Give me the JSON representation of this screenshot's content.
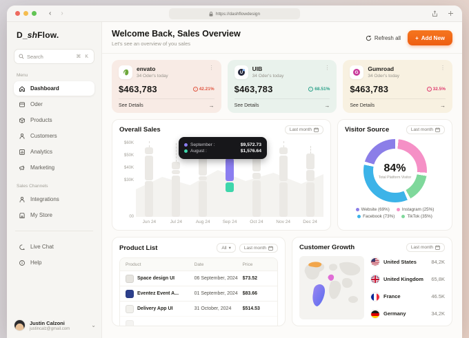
{
  "browser": {
    "url": "https://dashflowdesign"
  },
  "sidebar": {
    "logo_a": "D_",
    "logo_b": "sh",
    "logo_c": "Flow.",
    "search": {
      "placeholder": "Search",
      "shortcut": "⌘ K"
    },
    "menu_label": "Menu",
    "menu": [
      {
        "label": "Dashboard",
        "icon": "home-icon",
        "active": true
      },
      {
        "label": "Oder",
        "icon": "order-icon",
        "active": false
      },
      {
        "label": "Products",
        "icon": "products-icon",
        "active": false
      },
      {
        "label": "Customers",
        "icon": "customers-icon",
        "active": false
      },
      {
        "label": "Analytics",
        "icon": "analytics-icon",
        "active": false
      },
      {
        "label": "Marketing",
        "icon": "marketing-icon",
        "active": false
      }
    ],
    "sales_label": "Sales Channels",
    "sales": [
      {
        "label": "Integrations",
        "icon": "integrations-icon"
      },
      {
        "label": "My Store",
        "icon": "store-icon"
      }
    ],
    "footer": [
      {
        "label": "Live Chat",
        "icon": "chat-icon"
      },
      {
        "label": "Help",
        "icon": "help-icon"
      }
    ],
    "user": {
      "name": "Justin Calzoni",
      "email": "justincalz@gmail.com"
    }
  },
  "header": {
    "title": "Welcome Back, Sales Overview",
    "subtitle": "Let's see an overview of you sales",
    "refresh_label": "Refresh all",
    "add_label": "Add New"
  },
  "stat_cards": [
    {
      "name": "envato",
      "subtitle": "34 Oder's today",
      "value": "$463,783",
      "delta": "42.21%",
      "delta_color": "#e05540",
      "bg": "#f8ebe5",
      "logo": "envato",
      "see_details": "See Details"
    },
    {
      "name": "UIB",
      "subtitle": "34 Oder's today",
      "value": "$463,783",
      "delta": "68.51%",
      "delta_color": "#2ba189",
      "bg": "#e9f2ec",
      "logo": "uib",
      "see_details": "See Details"
    },
    {
      "name": "Gumroad",
      "subtitle": "34 Oder's today",
      "value": "$463,783",
      "delta": "32.5%",
      "delta_color": "#df3a6e",
      "bg": "#f8f1e1",
      "logo": "gumroad",
      "see_details": "See Details"
    }
  ],
  "overall_sales": {
    "title": "Overall Sales",
    "period_label": "Last month",
    "chart_data": {
      "type": "bar",
      "title": "Overall Sales",
      "x": [
        "Jun 24",
        "Jul 24",
        "Aug 24",
        "Sep 24",
        "Oct 24",
        "Nov 24",
        "Dec 24"
      ],
      "ylabels": [
        {
          "v": 60,
          "t": "$60K"
        },
        {
          "v": 50,
          "t": "$50K"
        },
        {
          "v": 40,
          "t": "$40K"
        },
        {
          "v": 30,
          "t": "$30K"
        },
        {
          "v": 0,
          "t": "00"
        }
      ],
      "ylim": [
        0,
        63
      ],
      "unit": "K USD",
      "bars": [
        {
          "month": "Jun 24",
          "wick": 62,
          "segments": [
            {
              "from": 0,
              "to": 29
            },
            {
              "from": 30,
              "to": 50
            },
            {
              "from": 51,
              "to": 57
            }
          ]
        },
        {
          "month": "Jul 24",
          "wick": 60,
          "segments": [
            {
              "from": 0,
              "to": 34
            },
            {
              "from": 35,
              "to": 38
            },
            {
              "from": 39,
              "to": 45
            }
          ]
        },
        {
          "month": "Aug 24",
          "wick": 58,
          "segments": [
            {
              "from": 0,
              "to": 29
            },
            {
              "from": 30,
              "to": 33
            },
            {
              "from": 34,
              "to": 50
            }
          ]
        },
        {
          "month": "Sep 24",
          "wick": 56,
          "highlight": true,
          "segments": [
            {
              "from": 20,
              "to": 28,
              "color": "#3ed6ab"
            },
            {
              "from": 29.5,
              "to": 48,
              "color": "#8b7ef0"
            },
            {
              "from": 48.5,
              "to": 53,
              "color": "#f2b45f",
              "marker": true
            }
          ]
        },
        {
          "month": "Oct 24",
          "wick": 60,
          "segments": [
            {
              "from": 0,
              "to": 30
            },
            {
              "from": 31,
              "to": 36
            },
            {
              "from": 37,
              "to": 55
            }
          ]
        },
        {
          "month": "Nov 24",
          "wick": 62,
          "segments": [
            {
              "from": 0,
              "to": 28
            },
            {
              "from": 29,
              "to": 50
            },
            {
              "from": 51,
              "to": 57
            }
          ]
        },
        {
          "month": "Dec 24",
          "wick": 58,
          "segments": [
            {
              "from": 0,
              "to": 28
            },
            {
              "from": 29,
              "to": 38
            },
            {
              "from": 39,
              "to": 52
            }
          ]
        }
      ],
      "tooltip": [
        {
          "label": "September",
          "value": "$9,572.73",
          "color": "#8b7ef0"
        },
        {
          "label": "August",
          "value": "$1,576.64",
          "color": "#3ed6ab"
        }
      ]
    }
  },
  "visitor_source": {
    "title": "Visitor Source",
    "period_label": "Last month",
    "center_value": "84%",
    "center_label": "Total Platform Visitor",
    "chart_data": {
      "type": "pie",
      "title": "Visitor Source",
      "center_value": "84%",
      "slices": [
        {
          "name": "Instagram",
          "color": "#f590c6",
          "pct": 26
        },
        {
          "name": "TikTok",
          "color": "#7fd89b",
          "pct": 16
        },
        {
          "name": "Facebook",
          "color": "#3cb3e8",
          "pct": 36
        },
        {
          "name": "Website",
          "color": "#8b7ee8",
          "pct": 22
        }
      ]
    },
    "legend": [
      {
        "label": "Website (69%)",
        "color": "#8b7ee8"
      },
      {
        "label": "Instagram (25%)",
        "color": "#f590c6"
      },
      {
        "label": "Facebook (73%)",
        "color": "#3cb3e8"
      },
      {
        "label": "TikTok (35%)",
        "color": "#7fd89b"
      }
    ]
  },
  "product_list": {
    "title": "Product List",
    "filter_label": "All",
    "period_label": "Last month",
    "columns": [
      "Product",
      "Date",
      "Price"
    ],
    "rows": [
      {
        "product": "Space design UI",
        "date": "06 September, 2024",
        "price": "$73.52",
        "thumb": "#e6e4df"
      },
      {
        "product": "Eventez Event A...",
        "date": "01 September, 2024",
        "price": "$83.66",
        "thumb": "#2c3f8c"
      },
      {
        "product": "Delivery App UI",
        "date": "31 October, 2024",
        "price": "$514.53",
        "thumb": "#f1f0ec"
      }
    ]
  },
  "customer_growth": {
    "title": "Customer Growth",
    "period_label": "Last month",
    "rows": [
      {
        "country": "United States",
        "value": "84,2K",
        "flag": "us"
      },
      {
        "country": "United Kingdom",
        "value": "65,8K",
        "flag": "uk"
      },
      {
        "country": "France",
        "value": "46.5K",
        "flag": "fr"
      },
      {
        "country": "Germany",
        "value": "34,2K",
        "flag": "de"
      }
    ]
  }
}
